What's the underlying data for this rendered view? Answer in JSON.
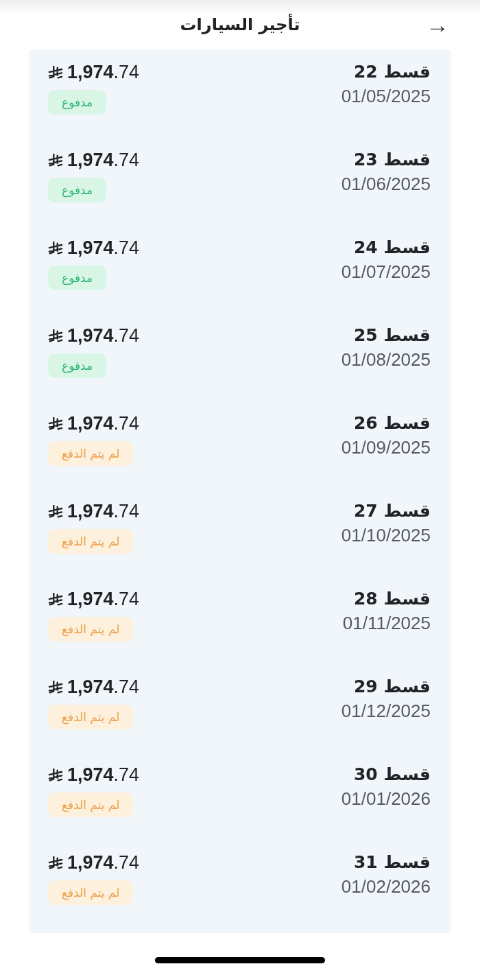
{
  "header": {
    "title": "تأجير السيارات",
    "back_icon": "→"
  },
  "installments": [
    {
      "title": "قسط 22",
      "date": "01/05/2025",
      "amount": "**1,974**.74",
      "status": {
        "kind": "paid",
        "label": "مدفوع"
      }
    },
    {
      "title": "قسط 23",
      "date": "01/06/2025",
      "amount": "**1,974**.74",
      "status": {
        "kind": "paid",
        "label": "مدفوع"
      }
    },
    {
      "title": "قسط 24",
      "date": "01/07/2025",
      "amount": "**1,974**.74",
      "status": {
        "kind": "paid",
        "label": "مدفوع"
      }
    },
    {
      "title": "قسط 25",
      "date": "01/08/2025",
      "amount": "**1,974**.74",
      "status": {
        "kind": "paid",
        "label": "مدفوع"
      }
    },
    {
      "title": "قسط 26",
      "date": "01/09/2025",
      "amount": "**1,974**.74",
      "status": {
        "kind": "unpaid",
        "label": "لم يتم الدفع"
      }
    },
    {
      "title": "قسط 27",
      "date": "01/10/2025",
      "amount": "**1,974**.74",
      "status": {
        "kind": "unpaid",
        "label": "لم يتم الدفع"
      }
    },
    {
      "title": "قسط 28",
      "date": "01/11/2025",
      "amount": "**1,974**.74",
      "status": {
        "kind": "unpaid",
        "label": "لم يتم الدفع"
      }
    },
    {
      "title": "قسط 29",
      "date": "01/12/2025",
      "amount": "**1,974**.74",
      "status": {
        "kind": "unpaid",
        "label": "لم يتم الدفع"
      }
    },
    {
      "title": "قسط 30",
      "date": "01/01/2026",
      "amount": "**1,974**.74",
      "status": {
        "kind": "unpaid",
        "label": "لم يتم الدفع"
      }
    },
    {
      "title": "قسط 31",
      "date": "01/02/2026",
      "amount": "**1,974**.74",
      "status": {
        "kind": "unpaid",
        "label": "لم يتم الدفع"
      }
    }
  ]
}
